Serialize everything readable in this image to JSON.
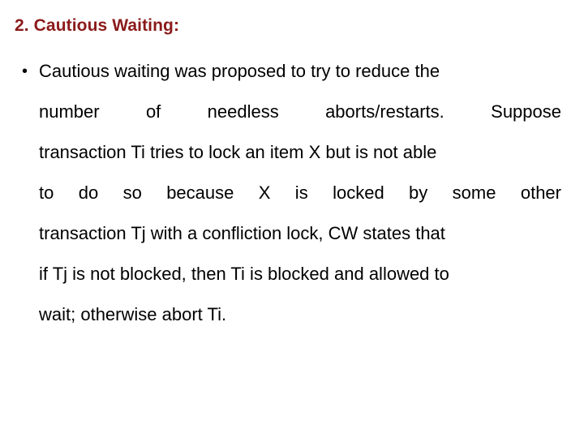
{
  "slide": {
    "background_color": "#ffffff",
    "title": "2. Cautious Waiting:",
    "title_color": "#8b1a1a",
    "body_color": "#000000",
    "bullet_glyph": "•",
    "bullets": [
      {
        "full_text": "Cautious waiting was proposed to try to reduce the number of needless aborts/restarts. Suppose transaction Ti tries to lock an item X but is not able to do so because X is locked by some other transaction Tj with a confliction lock, CW states that if Tj is not blocked, then Ti is blocked and allowed to wait; otherwise abort Ti.",
        "lines": [
          "Cautious waiting was proposed to try to reduce the",
          "number of needless aborts/restarts. Suppose",
          "transaction Ti tries to lock an item X but is not able",
          "to do so because X is locked by some other",
          "transaction Tj with a confliction lock, CW states that",
          "if Tj is not blocked, then Ti is blocked and allowed to",
          "wait; otherwise abort Ti."
        ]
      }
    ]
  }
}
